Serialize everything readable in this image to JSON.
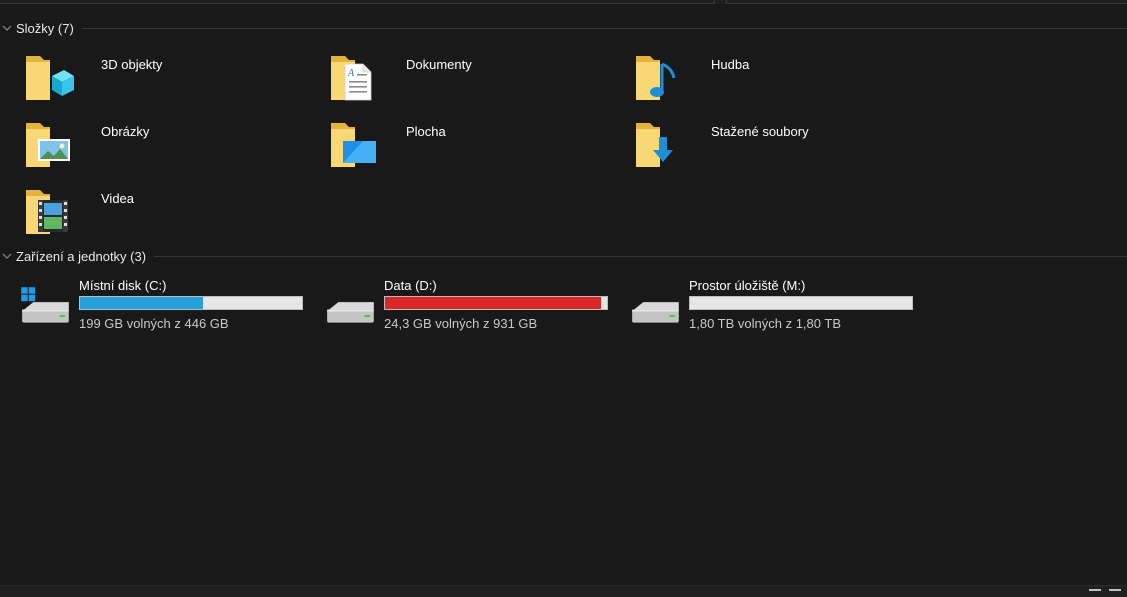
{
  "groups": {
    "folders": {
      "title": "Složky (7)",
      "items": [
        {
          "label": "3D objekty",
          "icon": "3d-objects-folder-icon"
        },
        {
          "label": "Dokumenty",
          "icon": "documents-folder-icon"
        },
        {
          "label": "Hudba",
          "icon": "music-folder-icon"
        },
        {
          "label": "Obrázky",
          "icon": "pictures-folder-icon"
        },
        {
          "label": "Plocha",
          "icon": "desktop-folder-icon"
        },
        {
          "label": "Stažené soubory",
          "icon": "downloads-folder-icon"
        },
        {
          "label": "Videa",
          "icon": "videos-folder-icon"
        }
      ]
    },
    "drives": {
      "title": "Zařízení a jednotky (3)",
      "items": [
        {
          "name": "Místní disk (C:)",
          "free_text": "199 GB volných z 446 GB",
          "used_fraction": 0.554,
          "fill_color": "#26a0da",
          "icon": "system-drive-icon"
        },
        {
          "name": "Data (D:)",
          "free_text": "24,3 GB volných z 931 GB",
          "used_fraction": 0.974,
          "fill_color": "#da2626",
          "icon": "hard-drive-icon"
        },
        {
          "name": "Prostor úložiště (M:)",
          "free_text": "1,80 TB volných z 1,80 TB",
          "used_fraction": 0.0,
          "fill_color": "#26a0da",
          "icon": "hard-drive-icon"
        }
      ]
    }
  },
  "colors": {
    "background": "#191919",
    "accent": "#26a0da",
    "critical": "#da2626",
    "folder_yellow": "#f8d775"
  }
}
